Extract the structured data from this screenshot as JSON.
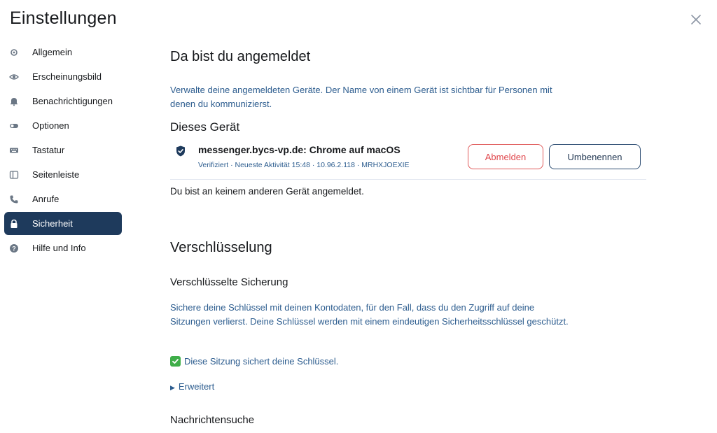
{
  "dialog": {
    "title": "Einstellungen",
    "close_icon": "close-icon"
  },
  "sidebar": {
    "items": [
      {
        "label": "Allgemein",
        "icon": "gear-icon",
        "active": false
      },
      {
        "label": "Erscheinungsbild",
        "icon": "eye-icon",
        "active": false
      },
      {
        "label": "Benachrichtigungen",
        "icon": "bell-icon",
        "active": false
      },
      {
        "label": "Optionen",
        "icon": "toggle-icon",
        "active": false
      },
      {
        "label": "Tastatur",
        "icon": "keyboard-icon",
        "active": false
      },
      {
        "label": "Seitenleiste",
        "icon": "sidebar-icon",
        "active": false
      },
      {
        "label": "Anrufe",
        "icon": "phone-icon",
        "active": false
      },
      {
        "label": "Sicherheit",
        "icon": "lock-icon",
        "active": true
      },
      {
        "label": "Hilfe und Info",
        "icon": "help-icon",
        "active": false
      }
    ]
  },
  "sessions": {
    "heading": "Da bist du angemeldet",
    "description": "Verwalte deine angemeldeten Geräte. Der Name von einem Gerät ist sichtbar für Personen mit denen du kommunizierst.",
    "this_device_heading": "Dieses Gerät",
    "device": {
      "name": "messenger.bycs-vp.de: Chrome auf macOS",
      "meta": "Verifiziert · Neueste Aktivität 15:48 · 10.96.2.118 · MRHXJOEXIE",
      "icon": "shield-check-icon",
      "signout_label": "Abmelden",
      "rename_label": "Umbenennen"
    },
    "no_other_devices": "Du bist an keinem anderen Gerät angemeldet."
  },
  "encryption": {
    "heading": "Verschlüsselung",
    "backup_heading": "Verschlüsselte Sicherung",
    "backup_description": "Sichere deine Schlüssel mit deinen Kontodaten, für den Fall, dass du den Zugriff auf deine Sitzungen verlierst. Deine Schlüssel werden mit einem eindeutigen Sicherheitsschlüssel geschützt.",
    "backup_status": "Diese Sitzung sichert deine Schlüssel.",
    "advanced_label": "Erweitert",
    "search_heading": "Nachrichtensuche"
  },
  "colors": {
    "accent": "#1e3a5c",
    "link_text": "#2d5d8f",
    "danger": "#e0474c",
    "success": "#3fae49"
  }
}
